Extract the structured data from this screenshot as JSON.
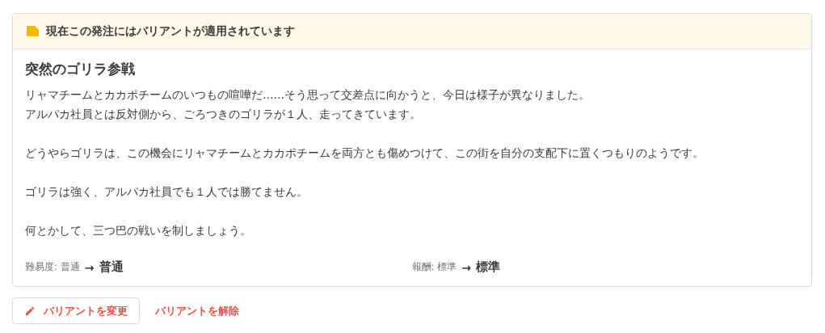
{
  "notice": {
    "text": "現在この発注にはバリアントが適用されています"
  },
  "variant": {
    "title": "突然のゴリラ参戦",
    "paragraphs": [
      [
        "リャマチームとカカポチームのいつもの喧嘩だ……そう思って交差点に向かうと、今日は様子が異なりました。",
        "アルパカ社員とは反対側から、ごろつきのゴリラが１人、走ってきています。"
      ],
      [
        "どうやらゴリラは、この機会にリャマチームとカカポチームを両方とも傷めつけて、この街を自分の支配下に置くつもりのようです。"
      ],
      [
        "ゴリラは強く、アルパカ社員でも１人では勝てません。"
      ],
      [
        "何とかして、三つ巴の戦いを制しましょう。"
      ]
    ],
    "changes": [
      {
        "label": "難易度: 普通",
        "arrow": "→",
        "value": "普通"
      },
      {
        "label": "報酬: 標準",
        "arrow": "→",
        "value": "標準"
      }
    ]
  },
  "buttons": [
    {
      "kind": "outlined",
      "label": "バリアントを変更"
    },
    {
      "kind": "text",
      "label": "バリアントを解除"
    }
  ]
}
